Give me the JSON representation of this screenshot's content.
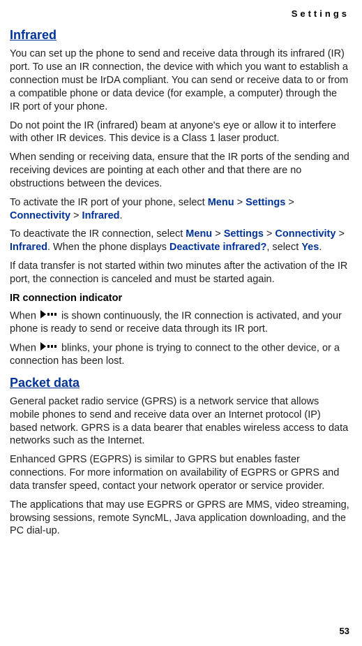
{
  "header": "Settings",
  "infrared": {
    "title": "Infrared",
    "p1": "You can set up the phone to send and receive data through its infrared (IR) port. To use an IR connection, the device with which you want to establish a connection must be IrDA compliant. You can send or receive data to or from a compatible phone or data device (for example, a computer) through the IR port of your phone.",
    "p2": "Do not point the IR (infrared) beam at anyone's eye or allow it to interfere with other IR devices. This device is a Class 1 laser product.",
    "p3": "When sending or receiving data, ensure that the IR ports of the sending and receiving devices are pointing at each other and that there are no obstructions between the devices.",
    "p4_prefix": "To activate the IR port of your phone, select ",
    "p4_suffix": ".",
    "p5_prefix": "To deactivate the IR connection, select ",
    "p5_mid": ". When the phone displays ",
    "p5_mid2": ", select ",
    "p5_suffix": ".",
    "p6": "If data transfer is not started within two minutes after the activation of the IR port, the connection is canceled and must be started again.",
    "indicator_heading": "IR connection indicator",
    "p7_prefix": "When ",
    "p7_suffix": " is shown continuously, the IR connection is activated, and your phone is ready to send or receive data through its IR port.",
    "p8_prefix": "When ",
    "p8_suffix": " blinks, your phone is trying to connect to the other device, or a connection has been lost."
  },
  "menu": {
    "menu": "Menu",
    "settings": "Settings",
    "connectivity": "Connectivity",
    "infrared": "Infrared",
    "deactivate": "Deactivate infrared?",
    "yes": "Yes",
    "gt": " > "
  },
  "packet_data": {
    "title": "Packet data",
    "p1": "General packet radio service (GPRS) is a network service that allows mobile phones to send and receive data over an Internet protocol (IP) based network. GPRS is a data bearer that enables wireless access to data networks such as the Internet.",
    "p2": "Enhanced GPRS (EGPRS) is similar to GPRS but enables faster connections. For more information on availability of EGPRS or GPRS and data transfer speed, contact your network operator or service provider.",
    "p3": "The applications that may use EGPRS or GPRS are MMS, video streaming, browsing sessions, remote SyncML, Java application downloading, and the PC dial-up."
  },
  "page_number": "53"
}
